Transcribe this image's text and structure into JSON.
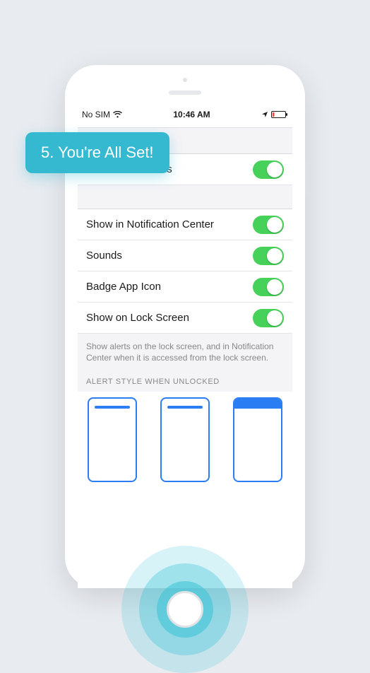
{
  "callout": {
    "text": "5. You're All Set!"
  },
  "status": {
    "carrier": "No SIM",
    "time": "10:46 AM"
  },
  "rows": {
    "allow": "Allow Notifications",
    "center": "Show in Notification Center",
    "sounds": "Sounds",
    "badge": "Badge App Icon",
    "lock": "Show on Lock Screen"
  },
  "footerText": "Show alerts on the lock screen, and in Notification Center when it is accessed from the lock screen.",
  "sectionHeader": "ALERT STYLE WHEN UNLOCKED"
}
